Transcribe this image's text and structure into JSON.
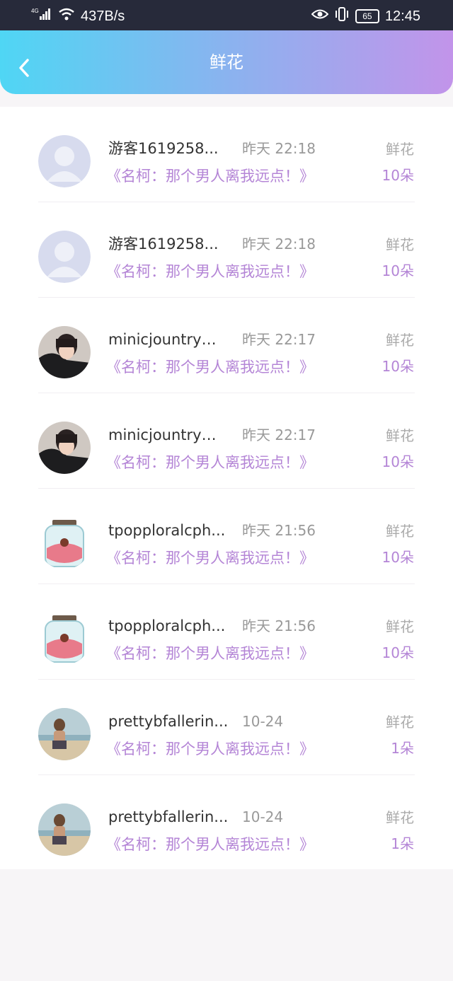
{
  "status_bar": {
    "network": "4G",
    "speed": "437B/s",
    "battery": "65",
    "time": "12:45"
  },
  "header": {
    "title": "鲜花",
    "back_icon": "chevron-left-icon"
  },
  "records": [
    {
      "username": "游客1619258...",
      "time": "昨天 22:18",
      "book": "《名柯：那个男人离我远点！》",
      "gift_label": "鲜花",
      "gift_count": "10朵",
      "avatar": "default-avatar"
    },
    {
      "username": "游客1619258...",
      "time": "昨天 22:18",
      "book": "《名柯：那个男人离我远点！》",
      "gift_label": "鲜花",
      "gift_count": "10朵",
      "avatar": "default-avatar"
    },
    {
      "username": "minicjountrym...",
      "time": "昨天 22:17",
      "book": "《名柯：那个男人离我远点！》",
      "gift_label": "鲜花",
      "gift_count": "10朵",
      "avatar": "photo-avatar"
    },
    {
      "username": "minicjountrym...",
      "time": "昨天 22:17",
      "book": "《名柯：那个男人离我远点！》",
      "gift_label": "鲜花",
      "gift_count": "10朵",
      "avatar": "photo-avatar"
    },
    {
      "username": "tpopploralcph...",
      "time": "昨天 21:56",
      "book": "《名柯：那个男人离我远点！》",
      "gift_label": "鲜花",
      "gift_count": "10朵",
      "avatar": "jar-avatar"
    },
    {
      "username": "tpopploralcph...",
      "time": "昨天 21:56",
      "book": "《名柯：那个男人离我远点！》",
      "gift_label": "鲜花",
      "gift_count": "10朵",
      "avatar": "jar-avatar"
    },
    {
      "username": "prettybfallerin...",
      "time": "10-24",
      "book": "《名柯：那个男人离我远点！》",
      "gift_label": "鲜花",
      "gift_count": "1朵",
      "avatar": "beach-avatar"
    },
    {
      "username": "prettybfallerin...",
      "time": "10-24",
      "book": "《名柯：那个男人离我远点！》",
      "gift_label": "鲜花",
      "gift_count": "1朵",
      "avatar": "beach-avatar"
    }
  ],
  "colors": {
    "accent": "#b485d6",
    "header_start": "#4fd6f4",
    "header_end": "#c294ea"
  }
}
